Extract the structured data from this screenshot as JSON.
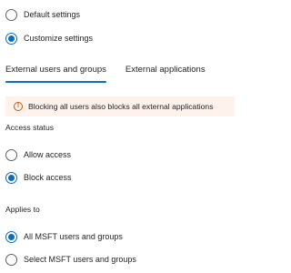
{
  "settings_mode": {
    "options": [
      {
        "label": "Default settings",
        "checked": false
      },
      {
        "label": "Customize settings",
        "checked": true
      }
    ]
  },
  "tabs": [
    {
      "label": "External users and groups",
      "active": true
    },
    {
      "label": "External applications",
      "active": false
    }
  ],
  "warning": {
    "icon": "warning-circle-icon",
    "text": "Blocking all users also blocks all external applications"
  },
  "access_status": {
    "label": "Access status",
    "options": [
      {
        "label": "Allow access",
        "checked": false
      },
      {
        "label": "Block access",
        "checked": true
      }
    ]
  },
  "applies_to": {
    "label": "Applies to",
    "options": [
      {
        "label": "All MSFT users and groups",
        "checked": true
      },
      {
        "label": "Select MSFT users and groups",
        "checked": false
      }
    ]
  },
  "colors": {
    "accent": "#0f6cbd",
    "warning_bg": "#fdf3ec",
    "warning_icon": "#c4590e",
    "text": "#242424"
  }
}
